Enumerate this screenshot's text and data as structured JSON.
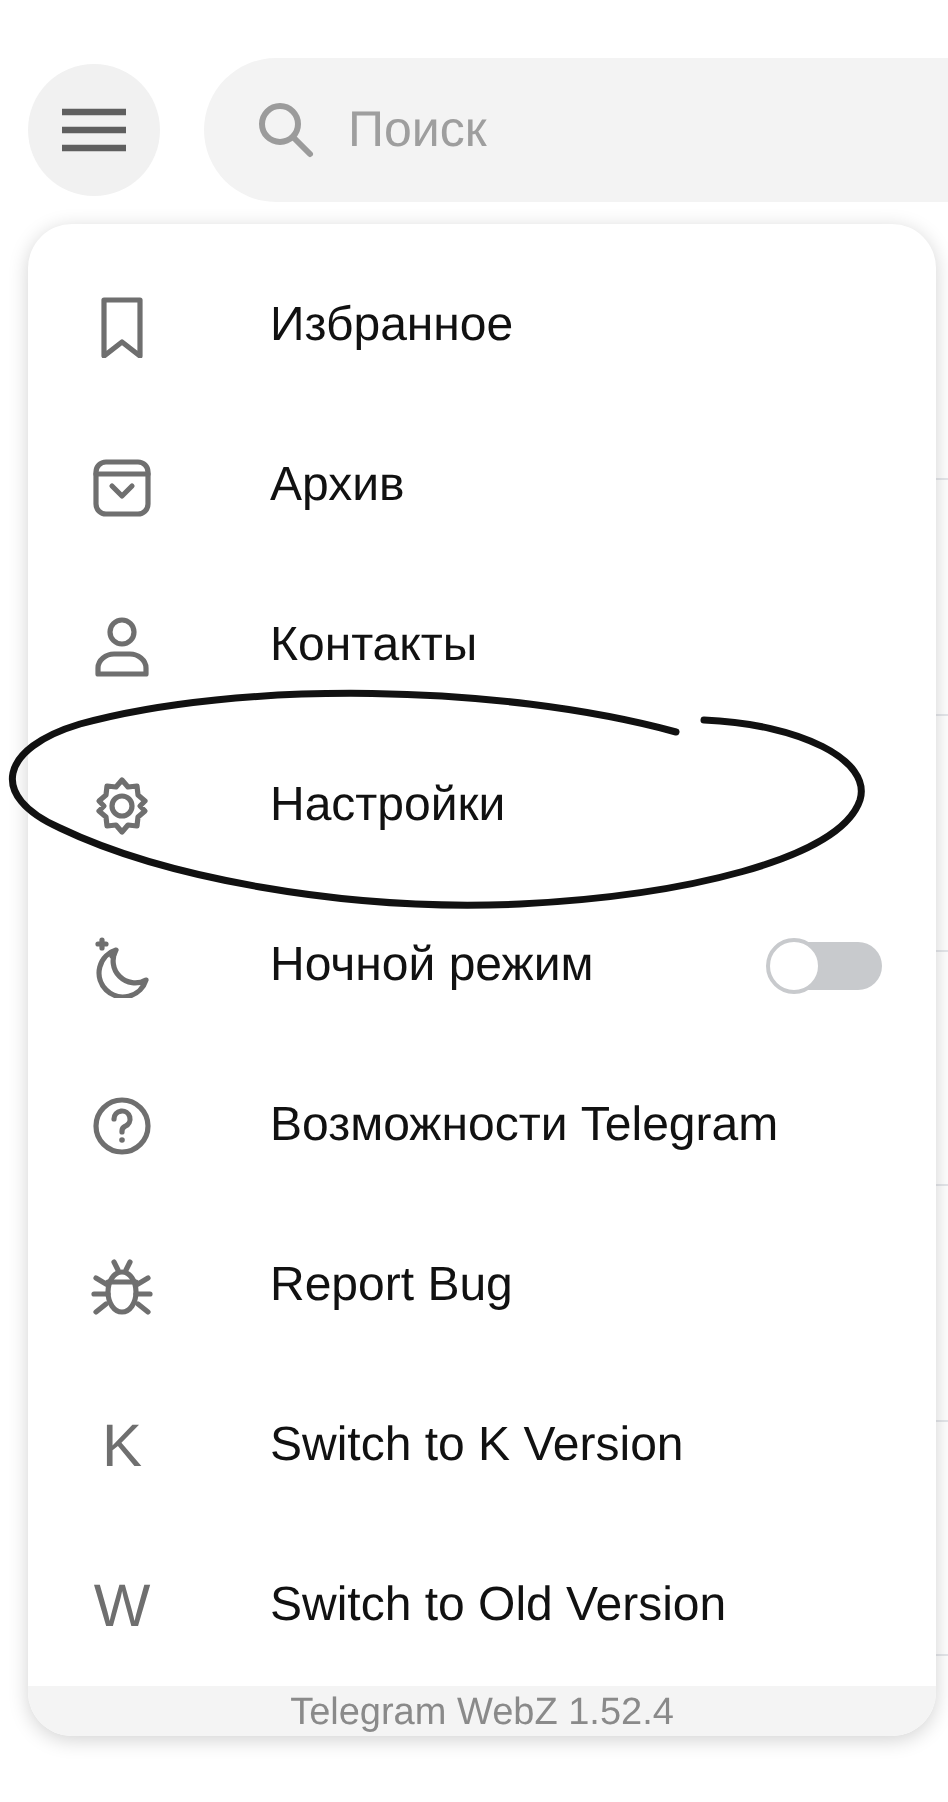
{
  "search": {
    "placeholder": "Поиск"
  },
  "menu": {
    "items": [
      {
        "kind": "link",
        "label": "Избранное"
      },
      {
        "kind": "link",
        "label": "Архив"
      },
      {
        "kind": "link",
        "label": "Контакты"
      },
      {
        "kind": "link",
        "label": "Настройки"
      },
      {
        "kind": "toggle",
        "label": "Ночной режим",
        "on": false
      },
      {
        "kind": "link",
        "label": "Возможности Telegram"
      },
      {
        "kind": "link",
        "label": "Report Bug"
      },
      {
        "kind": "letter",
        "icon_letter": "K",
        "label": "Switch to K Version"
      },
      {
        "kind": "letter",
        "icon_letter": "W",
        "label": "Switch to Old Version"
      }
    ],
    "footer": "Telegram WebZ 1.52.4"
  }
}
